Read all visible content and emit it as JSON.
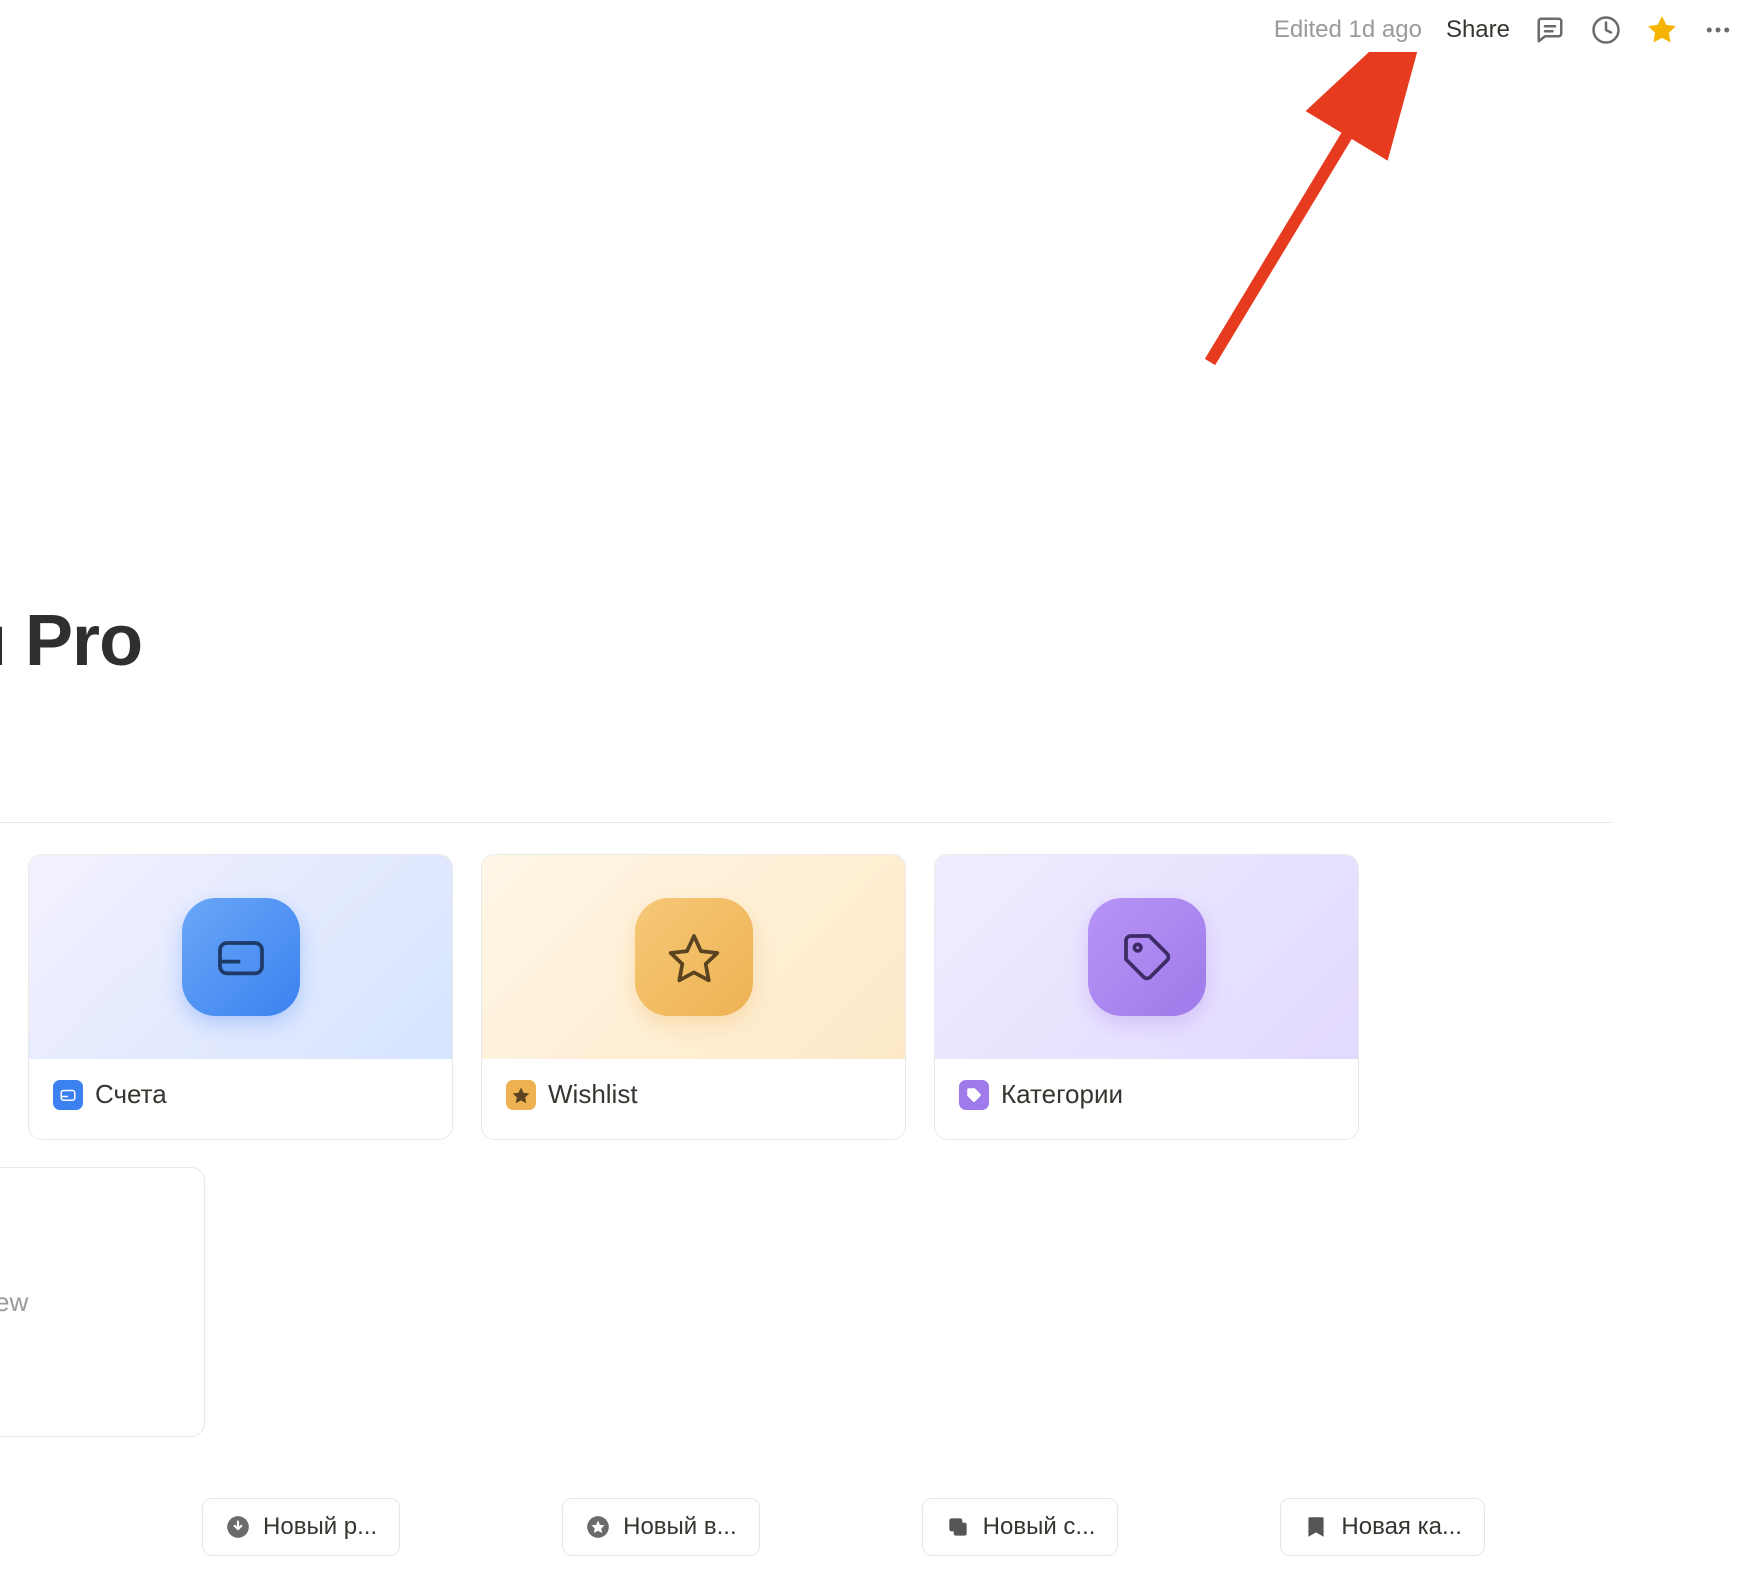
{
  "topbar": {
    "edited_text": "Edited 1d ago",
    "share_label": "Share"
  },
  "page": {
    "title": "ансами Pro"
  },
  "cards": [
    {
      "label": "Счета",
      "icon": "card-icon",
      "cover": "blue",
      "small": "blue"
    },
    {
      "label": "Wishlist",
      "icon": "star-icon",
      "cover": "yellow",
      "small": "yellow"
    },
    {
      "label": "Категории",
      "icon": "tag-icon",
      "cover": "purple",
      "small": "purple"
    }
  ],
  "partial_card": {
    "icon": "clock-icon",
    "cover": "orange"
  },
  "empty_card": {
    "label": "ew"
  },
  "actions": [
    {
      "label": "Новый р...",
      "icon": "download-circle-icon"
    },
    {
      "label": "Новый в...",
      "icon": "star-filled-icon"
    },
    {
      "label": "Новый с...",
      "icon": "copy-icon"
    },
    {
      "label": "Новая ка...",
      "icon": "bookmark-icon"
    }
  ],
  "colors": {
    "star_active": "#f5b400",
    "icon_gray": "#6b6b6b"
  }
}
